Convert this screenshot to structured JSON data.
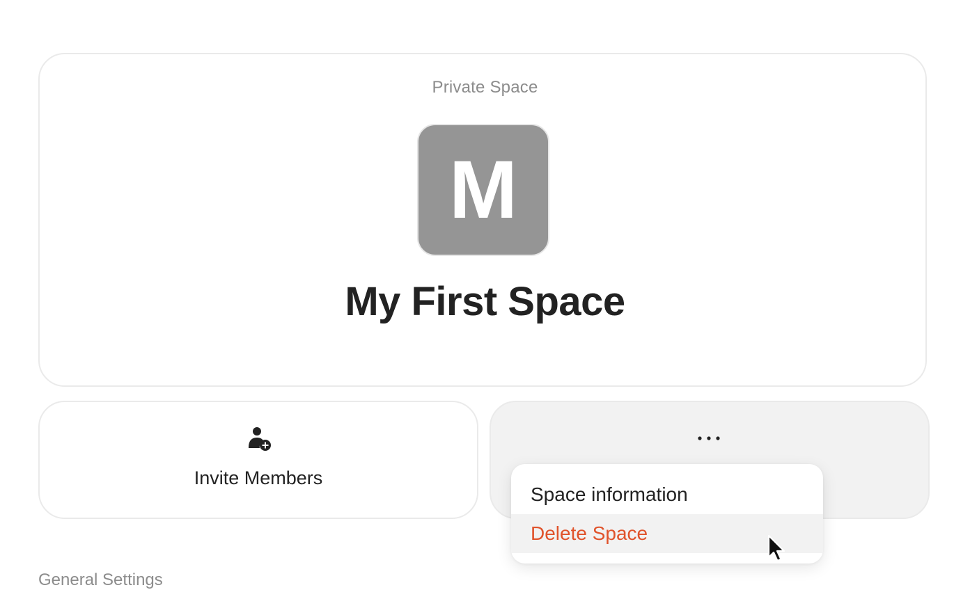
{
  "space": {
    "type_label": "Private Space",
    "avatar_letter": "M",
    "name": "My First Space",
    "avatar_color": "#959595"
  },
  "actions": {
    "invite": {
      "icon": "person-add-icon",
      "label": "Invite Members"
    },
    "more": {
      "icon": "more-horizontal-icon"
    }
  },
  "more_menu": {
    "items": [
      {
        "label": "Space information",
        "color": "#222222"
      },
      {
        "label": "Delete Space",
        "color": "#e0532b",
        "hovered": true
      }
    ]
  },
  "sections": {
    "general_settings": "General Settings"
  }
}
